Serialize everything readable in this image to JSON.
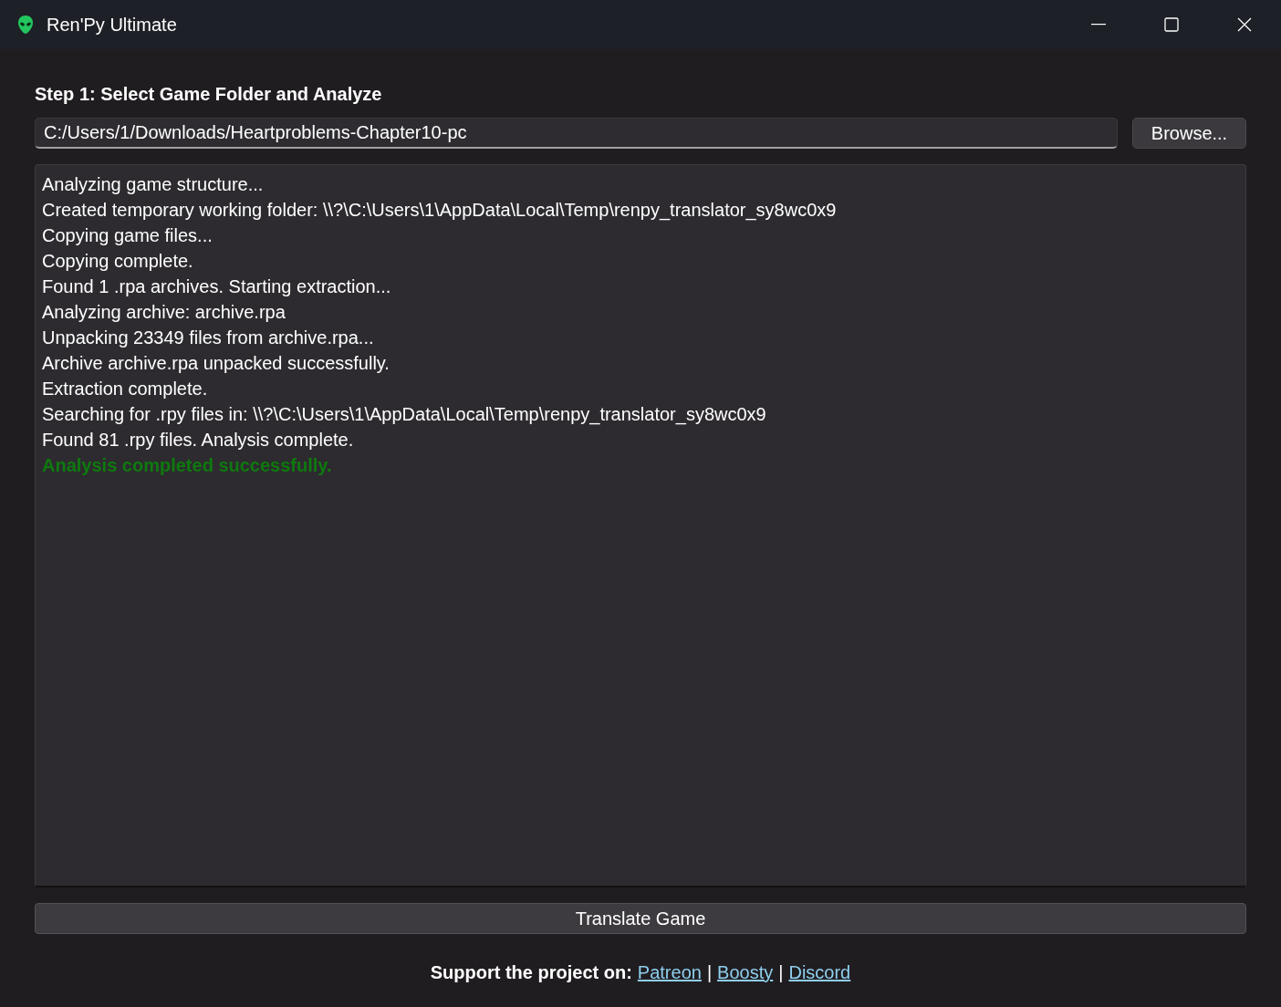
{
  "window": {
    "title": "Ren'Py Ultimate"
  },
  "step_heading": "Step 1: Select Game Folder and Analyze",
  "folder_field": {
    "value": "C:/Users/1/Downloads/Heartproblems-Chapter10-pc"
  },
  "browse_button": "Browse...",
  "log": [
    {
      "kind": "info",
      "text": "Analyzing game structure..."
    },
    {
      "kind": "info",
      "text": "Created temporary working folder: \\\\?\\C:\\Users\\1\\AppData\\Local\\Temp\\renpy_translator_sy8wc0x9"
    },
    {
      "kind": "info",
      "text": "Copying game files..."
    },
    {
      "kind": "info",
      "text": "Copying complete."
    },
    {
      "kind": "info",
      "text": "Found 1 .rpa archives. Starting extraction..."
    },
    {
      "kind": "info",
      "text": "Analyzing archive: archive.rpa"
    },
    {
      "kind": "info",
      "text": "Unpacking 23349 files from archive.rpa..."
    },
    {
      "kind": "info",
      "text": "Archive archive.rpa unpacked successfully."
    },
    {
      "kind": "info",
      "text": "Extraction complete."
    },
    {
      "kind": "info",
      "text": "Searching for .rpy files in: \\\\?\\C:\\Users\\1\\AppData\\Local\\Temp\\renpy_translator_sy8wc0x9"
    },
    {
      "kind": "info",
      "text": "Found 81 .rpy files. Analysis complete."
    },
    {
      "kind": "success",
      "text": "Analysis completed successfully."
    }
  ],
  "translate_button": "Translate Game",
  "footer": {
    "label": "Support the project on:",
    "items": [
      {
        "kind": "link",
        "text": "Patreon"
      },
      {
        "kind": "separator",
        "text": "|"
      },
      {
        "kind": "link",
        "text": "Boosty"
      },
      {
        "kind": "separator",
        "text": "|"
      },
      {
        "kind": "link",
        "text": "Discord"
      }
    ]
  }
}
